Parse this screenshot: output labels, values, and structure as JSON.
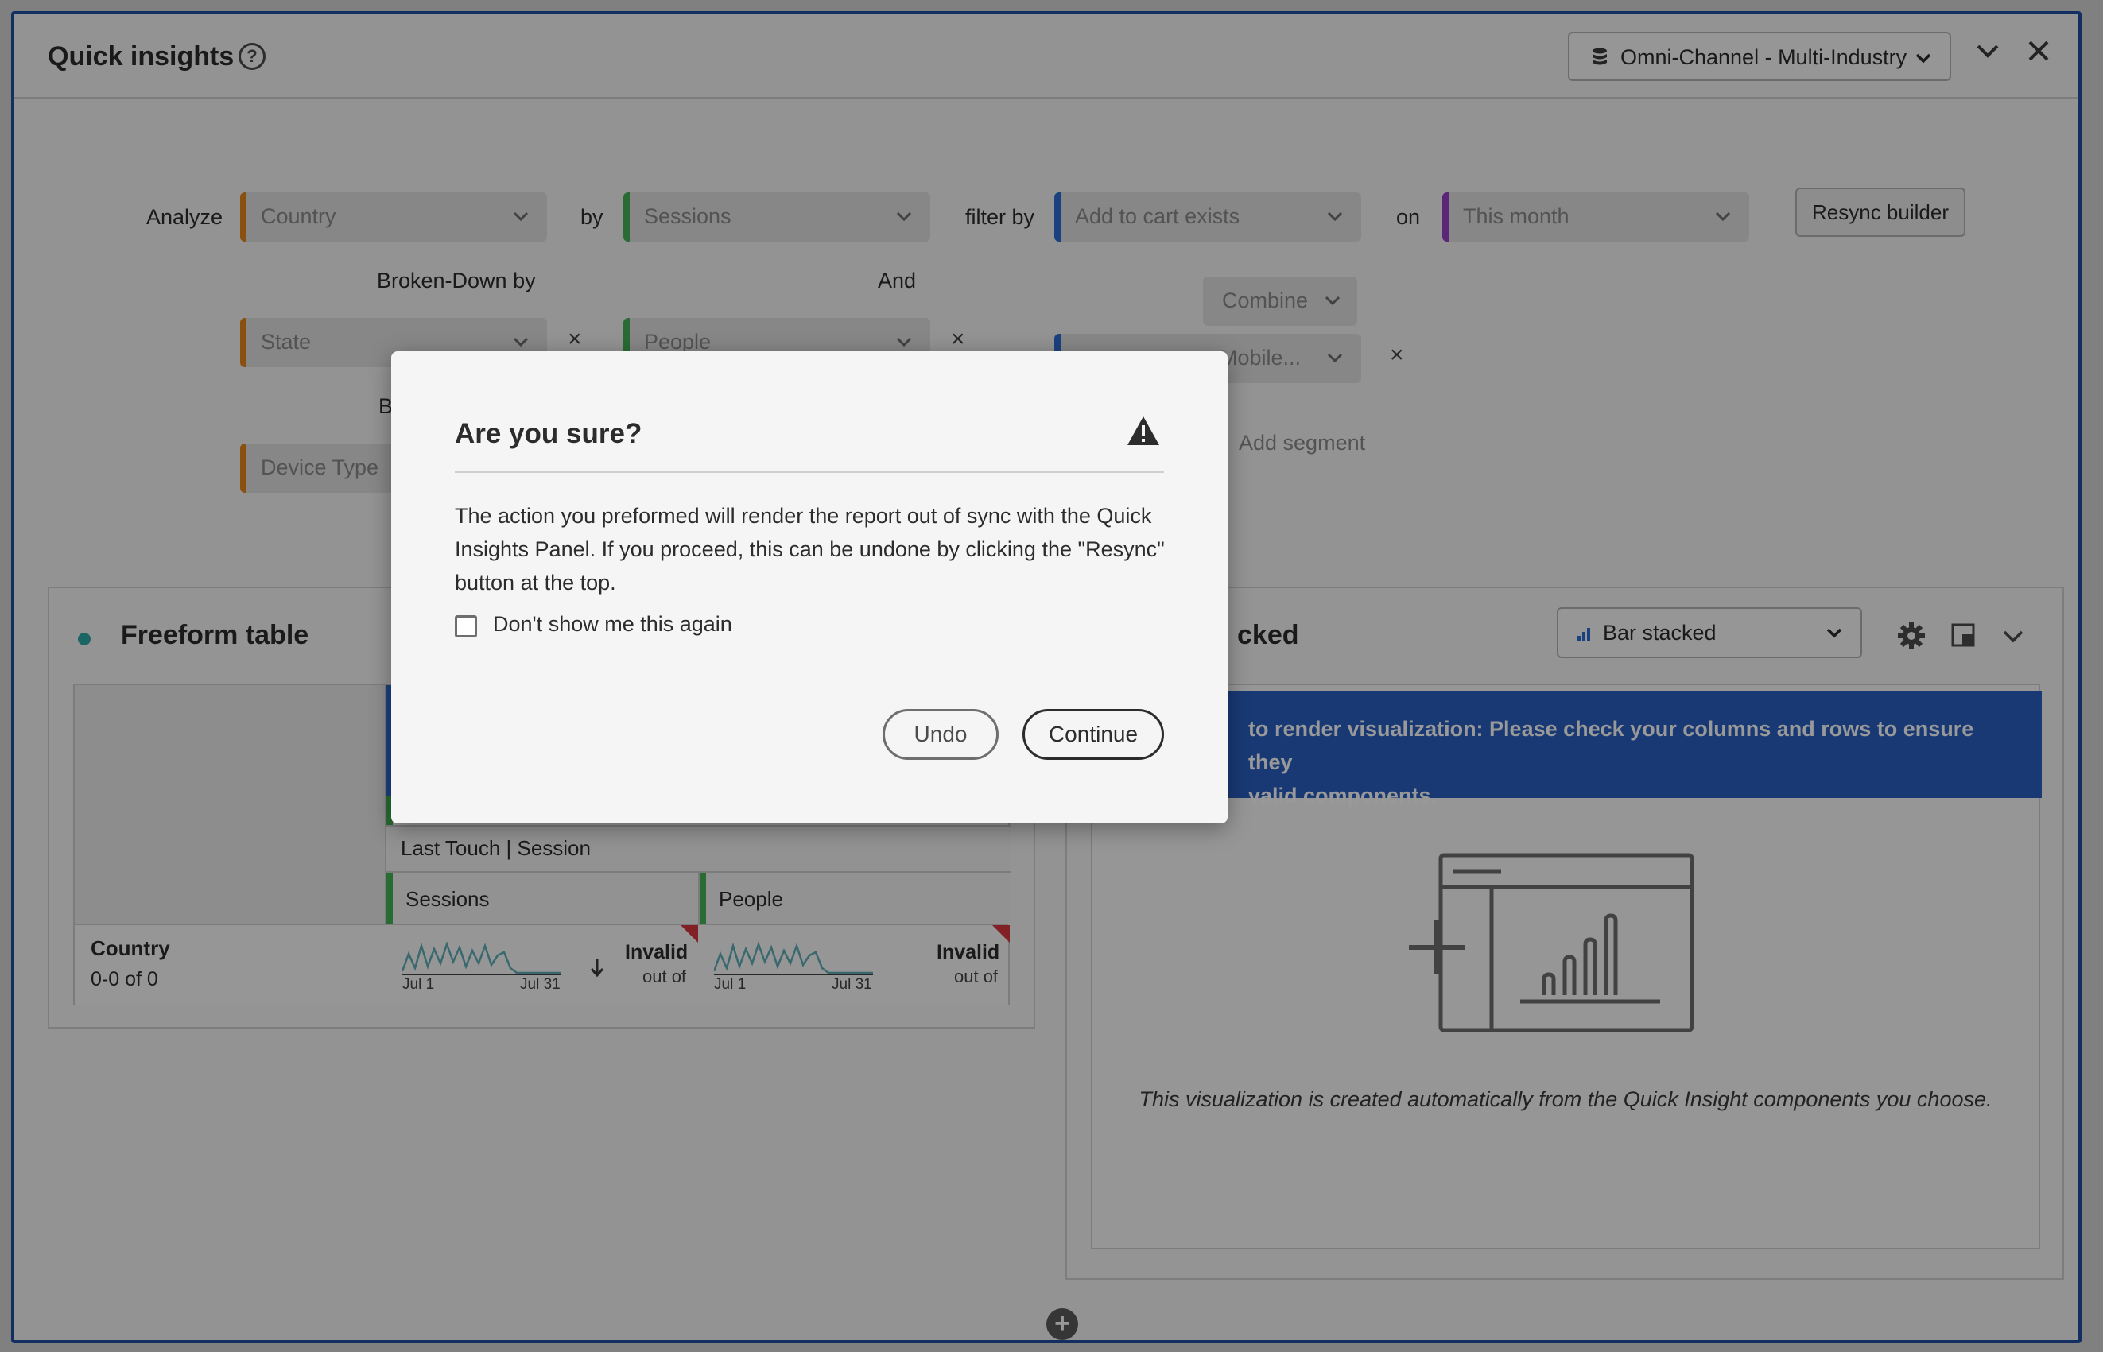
{
  "header": {
    "title": "Quick insights",
    "help_icon": "help-icon",
    "data_source": "Omni-Channel - Multi-Industry"
  },
  "builder": {
    "analyze_label": "Analyze",
    "by_label": "by",
    "filter_by_label": "filter by",
    "on_label": "on",
    "broken_down_label": "Broken-Down by",
    "and_label": "And",
    "broken_partial_label": "Br",
    "dimension": "Country",
    "metric": "Sessions",
    "segment": "Add to cart exists",
    "date_range": "This month",
    "breakdown_1": "State",
    "metric_2": "People",
    "segment_2": "Mobile...",
    "breakdown_2": "Device Type",
    "combine_label": "Combine",
    "add_segment_label": "Add segment",
    "resync_label": "Resync builder"
  },
  "freeform": {
    "title": "Freeform table",
    "attribution_label": "Last Touch | Session",
    "col_sessions": "Sessions",
    "col_people": "People",
    "row_header": "Country",
    "row_count": "0-0 of 0",
    "tick_start": "Jul 1",
    "tick_end": "Jul 31",
    "invalid_label": "Invalid",
    "out_of_label": "out of"
  },
  "viz": {
    "title_partial": "cked",
    "type_label": "Bar stacked",
    "banner_text": "to render visualization: Please check your columns and rows to ensure they\nvalid components.",
    "caption": "This visualization is created automatically from the Quick Insight components you choose."
  },
  "dialog": {
    "title": "Are you sure?",
    "body": "The action you preformed will render the report out of sync with the Quick Insights Panel. If you proceed, this can be undone by clicking the \"Resync\" button at the top.",
    "checkbox_label": "Don't show me this again",
    "undo_label": "Undo",
    "continue_label": "Continue"
  },
  "colors": {
    "panel_border": "#1f4fa3",
    "dimension_orange": "#e68619",
    "metric_green": "#44b556",
    "segment_blue": "#2d6fd6",
    "date_purple": "#9a3fc7",
    "banner_blue": "#2a5fc2",
    "error_red": "#d7373f"
  }
}
